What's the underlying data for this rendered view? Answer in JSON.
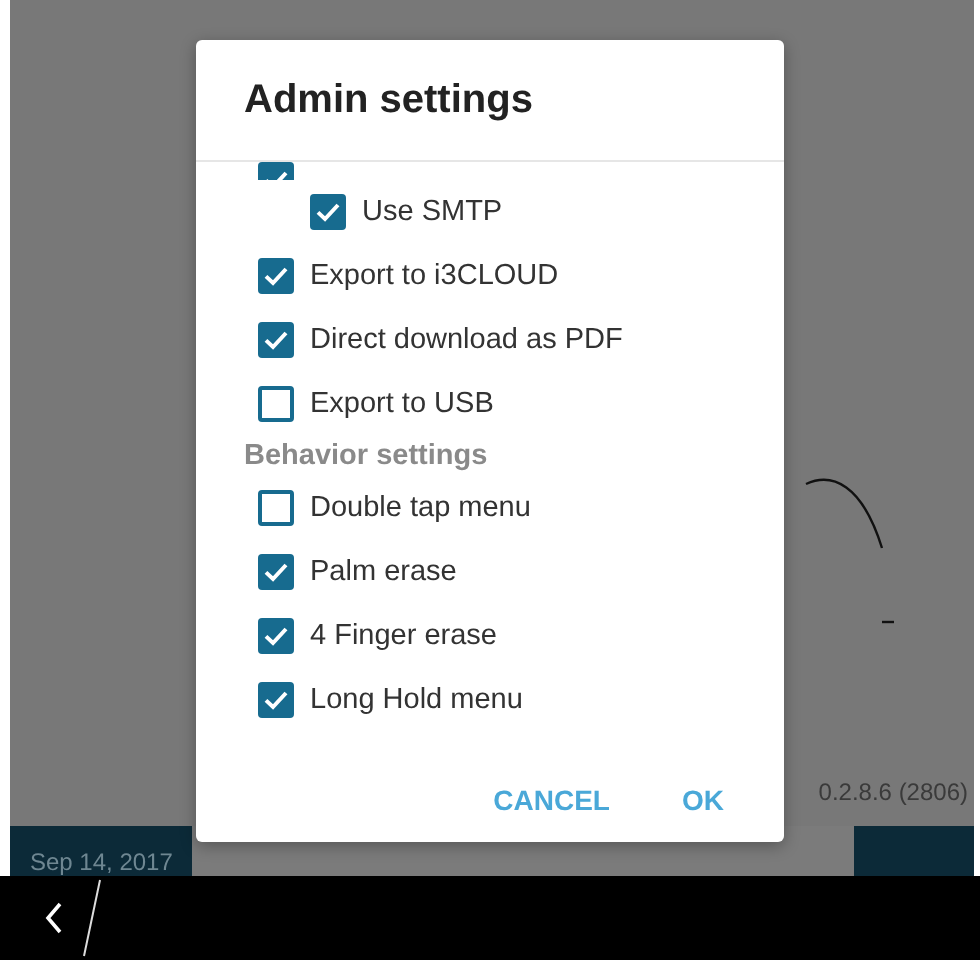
{
  "background": {
    "version": "0.2.8.6 (2806)",
    "date": "Sep 14, 2017"
  },
  "dialog": {
    "title": "Admin settings",
    "items": [
      {
        "kind": "checkbox",
        "checked": true,
        "children": [
          {
            "kind": "checkbox",
            "label": "Use SMTP",
            "checked": true
          }
        ]
      },
      {
        "kind": "checkbox",
        "label": "Export to i3CLOUD",
        "checked": true
      },
      {
        "kind": "checkbox",
        "label": "Direct download as PDF",
        "checked": true
      },
      {
        "kind": "checkbox",
        "label": "Export to USB",
        "checked": false
      },
      {
        "kind": "header",
        "label": "Behavior settings"
      },
      {
        "kind": "checkbox",
        "label": "Double tap menu",
        "checked": false
      },
      {
        "kind": "checkbox",
        "label": "Palm erase",
        "checked": true
      },
      {
        "kind": "checkbox",
        "label": "4 Finger erase",
        "checked": true
      },
      {
        "kind": "checkbox",
        "label": "Long Hold menu",
        "checked": true
      }
    ],
    "buttons": [
      "CANCEL",
      "OK"
    ]
  }
}
